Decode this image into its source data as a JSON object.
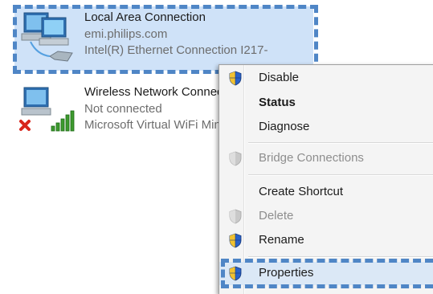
{
  "connections": [
    {
      "name": "Local Area Connection",
      "status": "emi.philips.com",
      "adapter": "Intel(R) Ethernet Connection I217-"
    },
    {
      "name": "Wireless Network Connection",
      "status": "Not connected",
      "adapter": "Microsoft Virtual WiFi Miniport Adapter"
    }
  ],
  "menu": {
    "disable": "Disable",
    "status": "Status",
    "diagnose": "Diagnose",
    "bridge": "Bridge Connections",
    "create_shortcut": "Create Shortcut",
    "delete": "Delete",
    "rename": "Rename",
    "properties": "Properties"
  },
  "colors": {
    "selection": "#cfe2f8",
    "highlight_dash": "#4f86c6",
    "shield_blue": "#2a62c8",
    "shield_yellow": "#f2c230"
  }
}
